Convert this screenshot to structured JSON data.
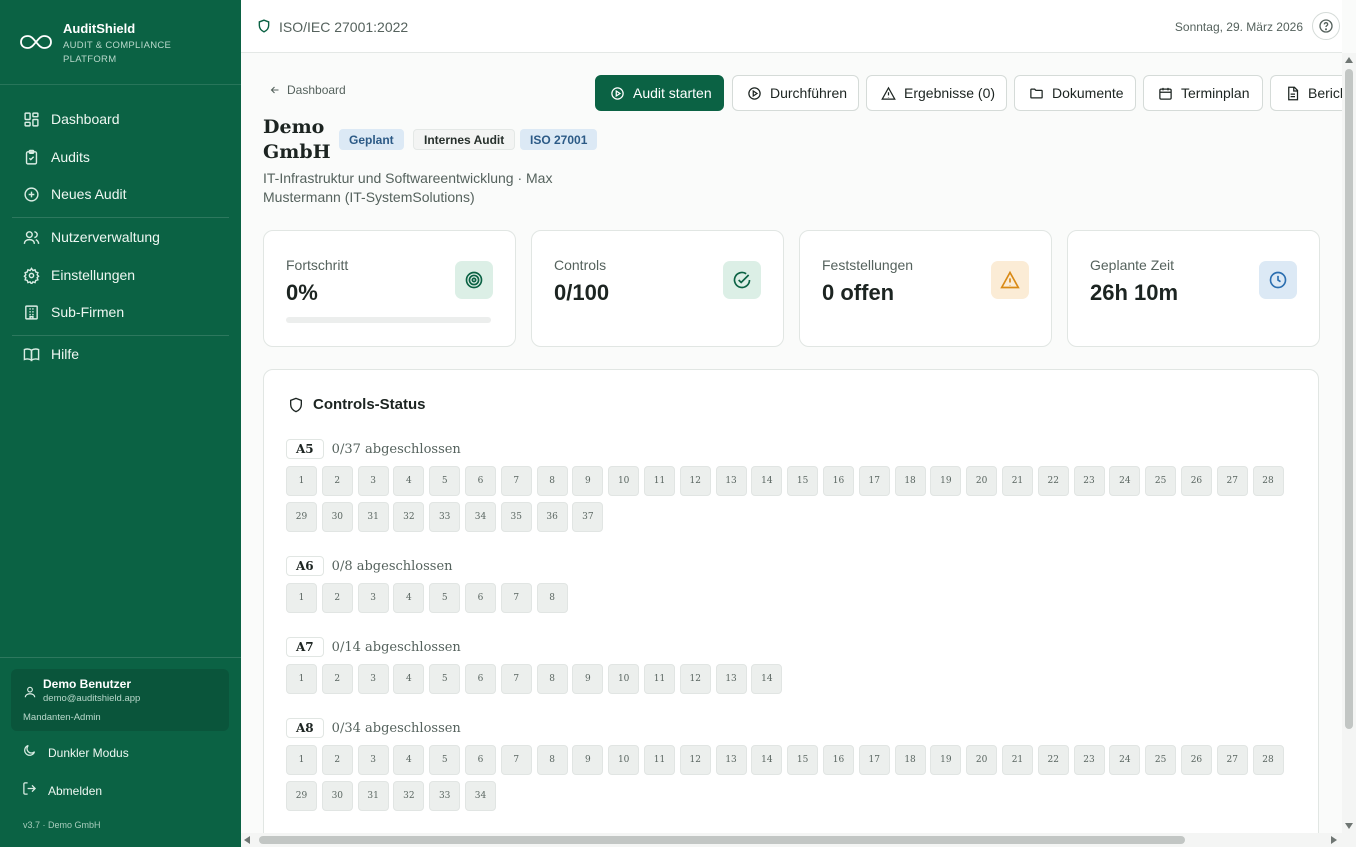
{
  "brand": {
    "title": "AuditShield",
    "subtitle": "AUDIT & COMPLIANCE PLATFORM"
  },
  "sidebar": {
    "items": [
      {
        "label": "Dashboard",
        "icon": "dashboard-icon"
      },
      {
        "label": "Audits",
        "icon": "clipboard-check-icon"
      },
      {
        "label": "Neues Audit",
        "icon": "plus-circle-icon"
      },
      {
        "label": "Nutzerverwaltung",
        "icon": "users-icon"
      },
      {
        "label": "Einstellungen",
        "icon": "gear-icon"
      },
      {
        "label": "Sub-Firmen",
        "icon": "building-icon"
      },
      {
        "label": "Hilfe",
        "icon": "book-icon"
      }
    ],
    "user": {
      "name": "Demo Benutzer",
      "email": "demo@auditshield.app",
      "role": "Mandanten-Admin"
    },
    "dark_mode": "Dunkler Modus",
    "logout": "Abmelden",
    "version": "v3.7 · Demo GmbH"
  },
  "topbar": {
    "standard": "ISO/IEC 27001:2022",
    "date": "Sonntag, 29. März 2026"
  },
  "header": {
    "back": "Dashboard",
    "company": "Demo GmbH",
    "badges": {
      "status": "Geplant",
      "type": "Internes Audit",
      "standard": "ISO 27001"
    },
    "description": "IT-Infrastruktur und Softwareentwicklung · Max Mustermann (IT-SystemSolutions)"
  },
  "actions": {
    "start": "Audit starten",
    "perform": "Durchführen",
    "results": "Ergebnisse (0)",
    "documents": "Dokumente",
    "schedule": "Terminplan",
    "report": "Bericht"
  },
  "stats": {
    "progress": {
      "label": "Fortschritt",
      "value": "0%",
      "fraction": 0
    },
    "controls": {
      "label": "Controls",
      "value": "0/100"
    },
    "findings": {
      "label": "Feststellungen",
      "value": "0 offen"
    },
    "time": {
      "label": "Geplante Zeit",
      "value": "26h 10m"
    }
  },
  "colors": {
    "primary": "#0b6244",
    "warning": "#d98a16",
    "info": "#2c6fb0"
  },
  "controls_status": {
    "title": "Controls-Status",
    "groups": [
      {
        "id": "A5",
        "summary": "0/37 abgeschlossen",
        "count": 37
      },
      {
        "id": "A6",
        "summary": "0/8 abgeschlossen",
        "count": 8
      },
      {
        "id": "A7",
        "summary": "0/14 abgeschlossen",
        "count": 14
      },
      {
        "id": "A8",
        "summary": "0/34 abgeschlossen",
        "count": 34
      }
    ]
  }
}
